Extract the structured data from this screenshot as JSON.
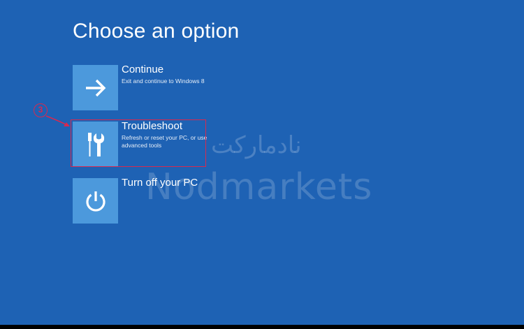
{
  "page": {
    "title": "Choose an option"
  },
  "options": [
    {
      "id": "continue",
      "title": "Continue",
      "description": "Exit and continue to Windows 8",
      "icon": "arrow-right-icon"
    },
    {
      "id": "troubleshoot",
      "title": "Troubleshoot",
      "description": "Refresh or reset your PC, or use advanced tools",
      "icon": "tools-icon"
    },
    {
      "id": "turn-off",
      "title": "Turn off your PC",
      "description": "",
      "icon": "power-icon"
    }
  ],
  "annotation": {
    "step": "3",
    "color": "#d8294f"
  },
  "watermark": {
    "persian": "نادمارکت",
    "latin": "Nodmarkets"
  },
  "colors": {
    "background": "#1e62b4",
    "tile": "#4c99dc",
    "text": "#ffffff"
  }
}
